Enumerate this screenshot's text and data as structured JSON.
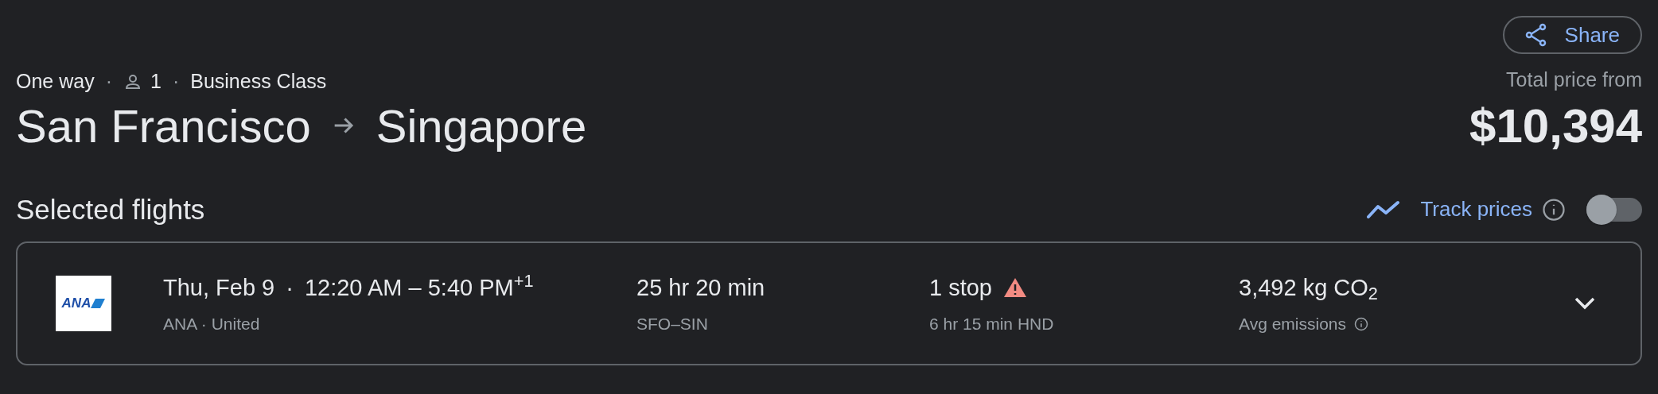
{
  "share_button": {
    "label": "Share"
  },
  "separator": "·",
  "trip": {
    "type": "One way",
    "passengers": "1",
    "cabin": "Business Class"
  },
  "route": {
    "origin": "San Francisco",
    "destination": "Singapore"
  },
  "price": {
    "label": "Total price from",
    "amount": "$10,394"
  },
  "section": {
    "title": "Selected flights",
    "track_prices": {
      "label": "Track prices",
      "on": false
    }
  },
  "flight": {
    "logo_text": "ANA",
    "date": "Thu, Feb 9",
    "times": "12:20 AM – 5:40 PM$^{+1}$",
    "airlines": "ANA · United",
    "duration": "25 hr 20 min",
    "airports": "SFO–SIN",
    "stops": "1 stop",
    "warning": true,
    "layover": "6 hr 15 min HND",
    "emissions": "3,492 kg CO$_{2}$",
    "emissions_label": "Avg emissions",
    "expanded": false
  }
}
